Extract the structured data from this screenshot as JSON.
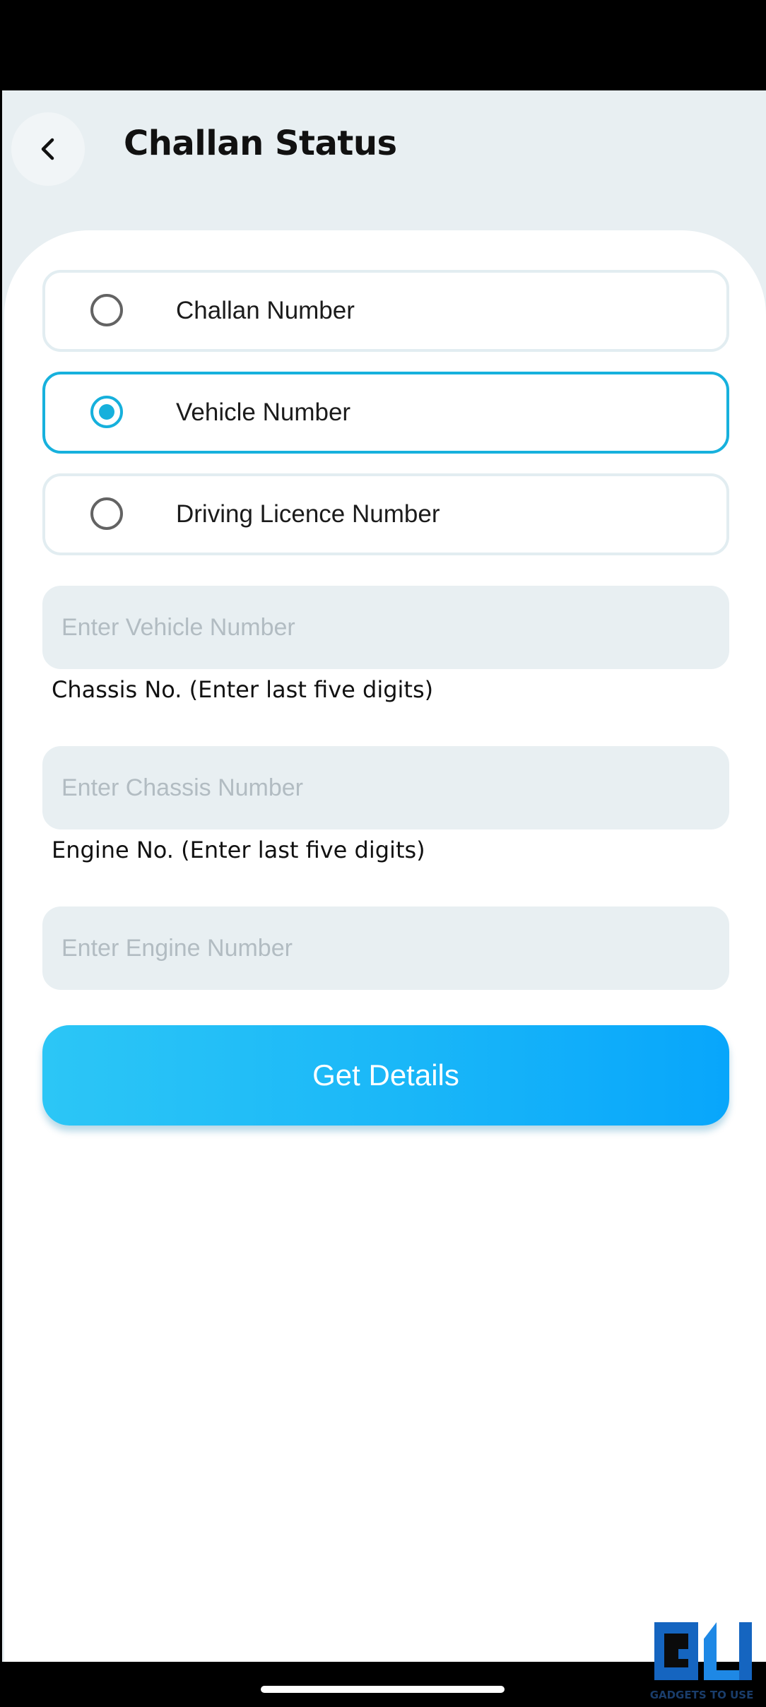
{
  "header": {
    "title": "Challan Status"
  },
  "search_type": {
    "options": [
      {
        "label": "Challan Number",
        "selected": false
      },
      {
        "label": "Vehicle Number",
        "selected": true
      },
      {
        "label": "Driving Licence Number",
        "selected": false
      }
    ]
  },
  "form": {
    "vehicle_number": {
      "placeholder": "Enter Vehicle Number",
      "value": ""
    },
    "chassis": {
      "label": "Chassis No. (Enter last five digits)",
      "placeholder": "Enter Chassis Number",
      "value": ""
    },
    "engine": {
      "label": "Engine No. (Enter last five digits)",
      "placeholder": "Enter Engine Number",
      "value": ""
    },
    "submit_label": "Get Details"
  },
  "watermark": {
    "text": "GADGETS TO USE"
  },
  "icons": {
    "back": "chevron-left-icon",
    "radio": "radio-button-icon"
  },
  "colors": {
    "accent": "#16b0dc",
    "button_gradient_start": "#2cc6f6",
    "button_gradient_end": "#08a6fb",
    "background": "#e8eff2",
    "card": "#ffffff"
  }
}
